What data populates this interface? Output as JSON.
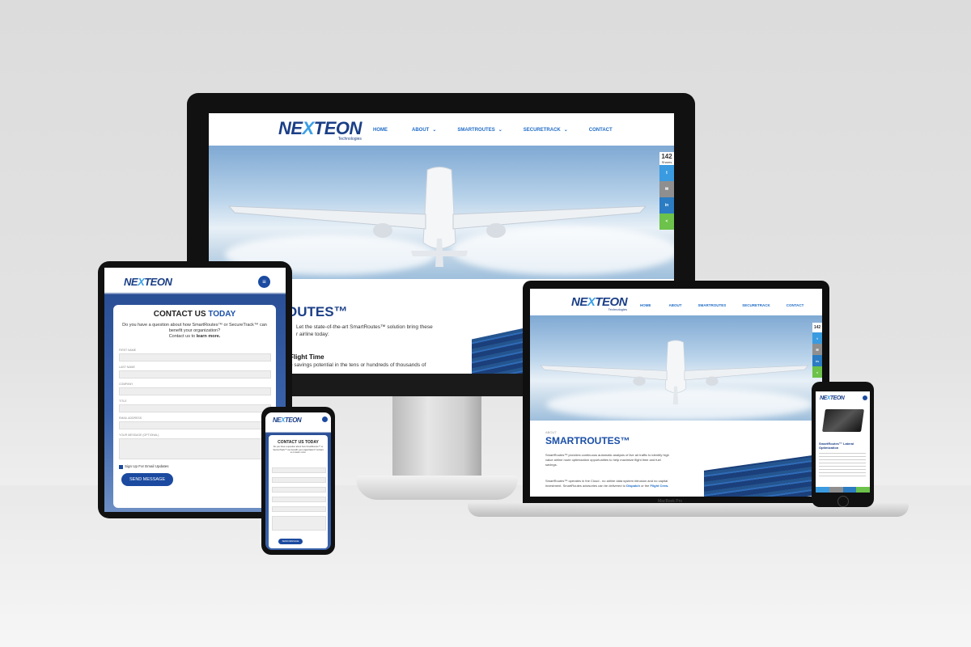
{
  "brand": {
    "logo_pre": "NE",
    "logo_x": "X",
    "logo_post": "TEON",
    "logo_sub": "Technologies",
    "accent": "#1f6cc7",
    "dark_blue": "#1b3f87"
  },
  "nav": {
    "home": "HOME",
    "about": "ABOUT",
    "smartroutes": "SMARTROUTES",
    "securetrack": "SECURETRACK",
    "contact": "CONTACT",
    "caret": "⌄"
  },
  "share": {
    "count": "142",
    "label": "Shares",
    "twitter": "t",
    "email": "✉",
    "linkedin": "in",
    "share": "<"
  },
  "monitor": {
    "heading": "OUTES™",
    "intro_line1": "Let the state-of-the-art SmartRoutes™ solution bring these",
    "intro_line2": "r airline today:",
    "subheading": "Flight Time",
    "sub_text": "e savings potential in the tens or hundreds of thousands of"
  },
  "laptop": {
    "breadcrumb": "ABOUT",
    "heading": "SMARTROUTES™",
    "para1_line1": "SmartRoutes™ provides continuous automatic analysis of live air traffic to identify high",
    "para1_line2": "value airline route optimization opportunities to help maximize flight time and fuel",
    "para1_line3": "savings.",
    "para2_line1": "SmartRoutes™ operates in the Cloud - no airline data system intrusion and no capital",
    "para2_line2": "investment. SmartRoutes advisories can be delivered to",
    "dispatch": "Dispatch",
    "or": "or the",
    "flight_crew": "Flight Crew.",
    "model": "MacBook Pro"
  },
  "tablet": {
    "title_a": "CONTACT US",
    "title_b": "TODAY",
    "q_line1": "Do you have a question about how SmartRoutes™ or SecureTrack™ can",
    "q_line2": "benefit your organization?",
    "q_line3": "Contact us to",
    "learn_more": "learn more.",
    "fields": [
      "FIRST NAME",
      "LAST NAME",
      "COMPANY",
      "TITLE",
      "EMAIL ADDRESS",
      "YOUR MESSAGE (OPTIONAL)"
    ],
    "signup": "Sign Up For Email Updates",
    "send": "SEND MESSAGE"
  },
  "phone_left": {
    "title": "CONTACT US TODAY",
    "q": "Do you have a question about how SmartRoutes™ or SecureTrack™ can benefit your organization? Contact us to learn more.",
    "send": "SEND MESSAGE"
  },
  "phone_right": {
    "caption": "SmartRoutes™ Lateral Optimization"
  }
}
